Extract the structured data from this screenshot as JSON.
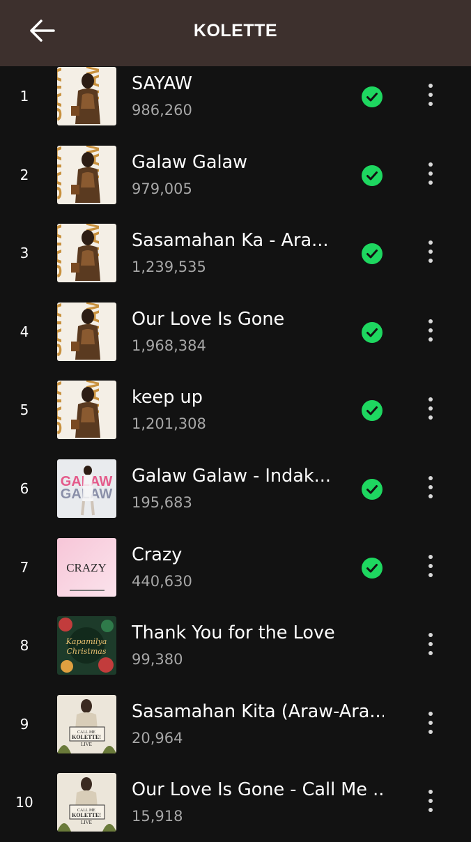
{
  "header": {
    "title": "KOLETTE",
    "back_icon": "arrow-left-icon"
  },
  "colors": {
    "header_bg": "#3d302d",
    "page_bg": "#121212",
    "check_green": "#1ed760",
    "secondary_text": "#a7a7a7"
  },
  "tracks": [
    {
      "rank": "1",
      "title": "SAYAW",
      "plays": "986,260",
      "downloaded": true,
      "art": "sayaw-cover"
    },
    {
      "rank": "2",
      "title": "Galaw Galaw",
      "plays": "979,005",
      "downloaded": true,
      "art": "sayaw-cover"
    },
    {
      "rank": "3",
      "title": "Sasamahan Ka - Ara...",
      "plays": "1,239,535",
      "downloaded": true,
      "art": "sayaw-cover"
    },
    {
      "rank": "4",
      "title": "Our Love Is Gone",
      "plays": "1,968,384",
      "downloaded": true,
      "art": "sayaw-cover"
    },
    {
      "rank": "5",
      "title": "keep up",
      "plays": "1,201,308",
      "downloaded": true,
      "art": "sayaw-cover"
    },
    {
      "rank": "6",
      "title": "Galaw Galaw - Indak...",
      "plays": "195,683",
      "downloaded": true,
      "art": "galaw-cover"
    },
    {
      "rank": "7",
      "title": "Crazy",
      "plays": "440,630",
      "downloaded": true,
      "art": "crazy-cover"
    },
    {
      "rank": "8",
      "title": "Thank You for the Love",
      "plays": "99,380",
      "downloaded": false,
      "art": "christmas-cover"
    },
    {
      "rank": "9",
      "title": "Sasamahan Kita (Araw-Ara...",
      "plays": "20,964",
      "downloaded": false,
      "art": "live-cover"
    },
    {
      "rank": "10",
      "title": "Our Love Is Gone - Call Me ...",
      "plays": "15,918",
      "downloaded": false,
      "art": "live-cover"
    }
  ],
  "covers": {
    "sayaw": {
      "text": "SAYAW"
    },
    "galaw": {
      "text": "GALAW"
    },
    "crazy": {
      "text": "CRAZY"
    },
    "christmas": {
      "text": "Kapamilya Christmas"
    },
    "live": {
      "text": "CALL ME KOLETTE! LIVE"
    }
  }
}
